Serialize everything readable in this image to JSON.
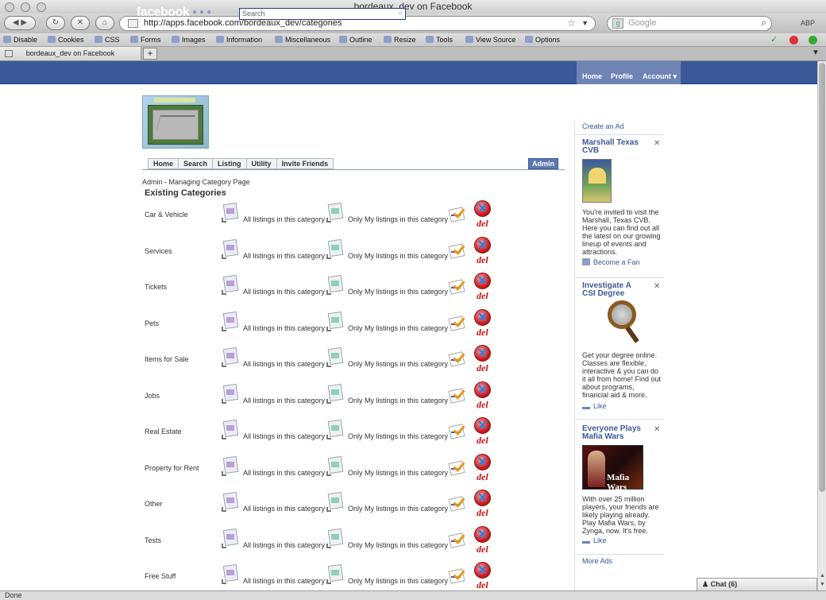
{
  "window": {
    "title": "bordeaux_dev on Facebook"
  },
  "browser": {
    "url": "http://apps.facebook.com/bordeaux_dev/categories",
    "search_placeholder": "Google",
    "abp": "ABP",
    "tab_title": "bordeaux_dev on Facebook",
    "status": "Done"
  },
  "devbar": [
    "Disable",
    "Cookies",
    "CSS",
    "Forms",
    "Images",
    "Information",
    "Miscellaneous",
    "Outline",
    "Resize",
    "Tools",
    "View Source",
    "Options"
  ],
  "fb": {
    "logo": "facebook",
    "search_placeholder": "Search",
    "nav": {
      "home": "Home",
      "profile": "Profile",
      "account": "Account ▾"
    }
  },
  "app": {
    "tabs": [
      "Home",
      "Search",
      "Listing",
      "Utility",
      "Invite Friends"
    ],
    "admin_tab": "Admin",
    "breadcrumb": "Admin - Managing Category Page",
    "heading": "Existing Categories",
    "all_label": "All listings in this category",
    "my_label": "Only My listings in this category",
    "del_label": "del",
    "categories": [
      "Car & Vehicle",
      "Services",
      "Tickets",
      "Pets",
      "Items for Sale",
      "Jobs",
      "Real Estate",
      "Property for Rent",
      "Other",
      "Tests",
      "Free Stuff"
    ]
  },
  "ads": {
    "create_ad": "Create an Ad",
    "more_ads": "More Ads",
    "items": [
      {
        "title": "Marshall Texas CVB",
        "text": "You're invited to visit the Marshall, Texas CVB. Here you can find out all the latest on our growing lineup of events and attractions.",
        "action": "Become a Fan"
      },
      {
        "title": "Investigate A CSI Degree",
        "text": "Get your degree online. Classes are flexible, interactive & you can do it all from home! Find out about programs, financial aid & more.",
        "action": "Like"
      },
      {
        "title": "Everyone Plays Mafia Wars",
        "text": "With over 25 million players, your friends are likely playing already. Play Mafia Wars, by Zynga, now. It's free.",
        "action": "Like",
        "image_text": "Mafia Wars"
      }
    ]
  },
  "chat": {
    "label": "Chat (6)"
  }
}
